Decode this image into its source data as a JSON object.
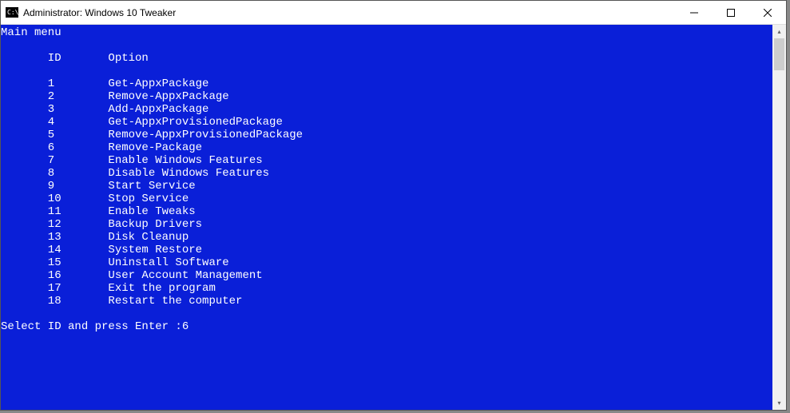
{
  "titlebar": {
    "text": "Administrator:  Windows 10 Tweaker"
  },
  "terminal": {
    "title": "Main menu",
    "header_id": "ID",
    "header_option": "Option",
    "items": [
      {
        "id": "1",
        "option": "Get-AppxPackage"
      },
      {
        "id": "2",
        "option": "Remove-AppxPackage"
      },
      {
        "id": "3",
        "option": "Add-AppxPackage"
      },
      {
        "id": "4",
        "option": "Get-AppxProvisionedPackage"
      },
      {
        "id": "5",
        "option": "Remove-AppxProvisionedPackage"
      },
      {
        "id": "6",
        "option": "Remove-Package"
      },
      {
        "id": "7",
        "option": "Enable Windows Features"
      },
      {
        "id": "8",
        "option": "Disable Windows Features"
      },
      {
        "id": "9",
        "option": "Start Service"
      },
      {
        "id": "10",
        "option": "Stop Service"
      },
      {
        "id": "11",
        "option": "Enable Tweaks"
      },
      {
        "id": "12",
        "option": "Backup Drivers"
      },
      {
        "id": "13",
        "option": "Disk Cleanup"
      },
      {
        "id": "14",
        "option": "System Restore"
      },
      {
        "id": "15",
        "option": "Uninstall Software"
      },
      {
        "id": "16",
        "option": "User Account Management"
      },
      {
        "id": "17",
        "option": "Exit the program"
      },
      {
        "id": "18",
        "option": "Restart the computer"
      }
    ],
    "prompt": "Select ID and press Enter :",
    "input_value": "6"
  }
}
